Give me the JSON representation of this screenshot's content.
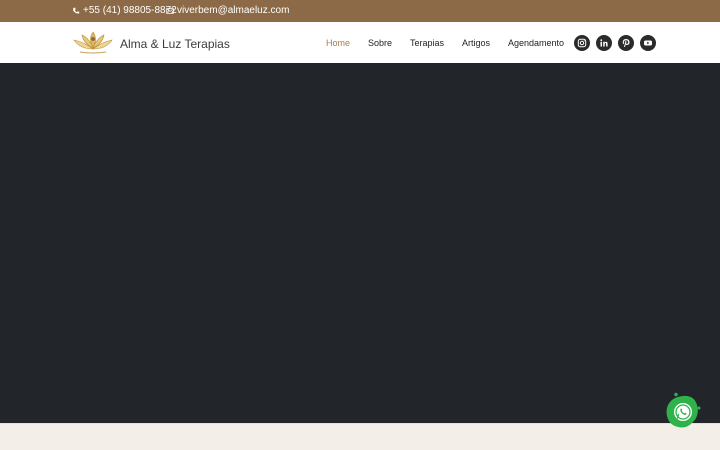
{
  "topbar": {
    "phone": "+55 (41) 98805-8872",
    "email": "viverbem@almaeluz.com",
    "background": "#8c6a47"
  },
  "header": {
    "brand_name": "Alma & Luz Terapias",
    "nav": [
      {
        "label": "Home",
        "active": true
      },
      {
        "label": "Sobre",
        "active": false
      },
      {
        "label": "Terapias",
        "active": false
      },
      {
        "label": "Artigos",
        "active": false
      },
      {
        "label": "Agendamento",
        "active": false
      }
    ],
    "social": [
      "instagram-icon",
      "linkedin-icon",
      "pinterest-icon",
      "youtube-icon"
    ],
    "accent": "#a97c50"
  },
  "hero": {
    "background": "#22252a"
  },
  "floating": {
    "icon": "whatsapp-icon",
    "color": "#2fb24a"
  }
}
